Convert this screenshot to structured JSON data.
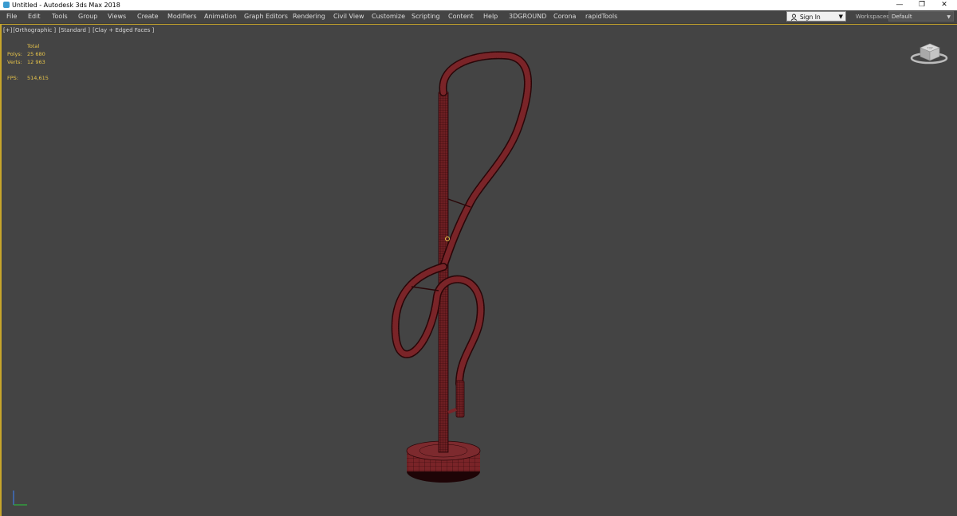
{
  "titlebar": {
    "title": "Untitled - Autodesk 3ds Max 2018",
    "minimize": "—",
    "restore": "❐",
    "close": "✕"
  },
  "menu": [
    "File",
    "Edit",
    "Tools",
    "Group",
    "Views",
    "Create",
    "Modifiers",
    "Animation",
    "Graph Editors",
    "Rendering",
    "Civil View",
    "Customize",
    "Scripting",
    "Content",
    "Help",
    "3DGROUND",
    "Corona",
    "rapidTools"
  ],
  "signin": {
    "label": "Sign In",
    "icon": "user-icon",
    "arrow": "▼"
  },
  "workspaces": {
    "label": "Workspaces:",
    "value": "Default",
    "arrow": "▼"
  },
  "viewport": {
    "labels": [
      "[+]",
      "[Orthographic ]",
      "[Standard ]",
      "[Clay + Edged Faces ]"
    ],
    "stats": {
      "total_label": "Total",
      "polys_label": "Polys:",
      "polys_value": "25 680",
      "verts_label": "Verts:",
      "verts_value": "12 963",
      "fps_label": "FPS:",
      "fps_value": "514,615"
    },
    "viewcube_face": "TOP"
  },
  "colors": {
    "viewport_bg": "#444444",
    "active_border": "#c7a52b",
    "stats_text": "#e6c34a",
    "model_red": "#6e1f23",
    "model_edge": "#2a0608"
  }
}
